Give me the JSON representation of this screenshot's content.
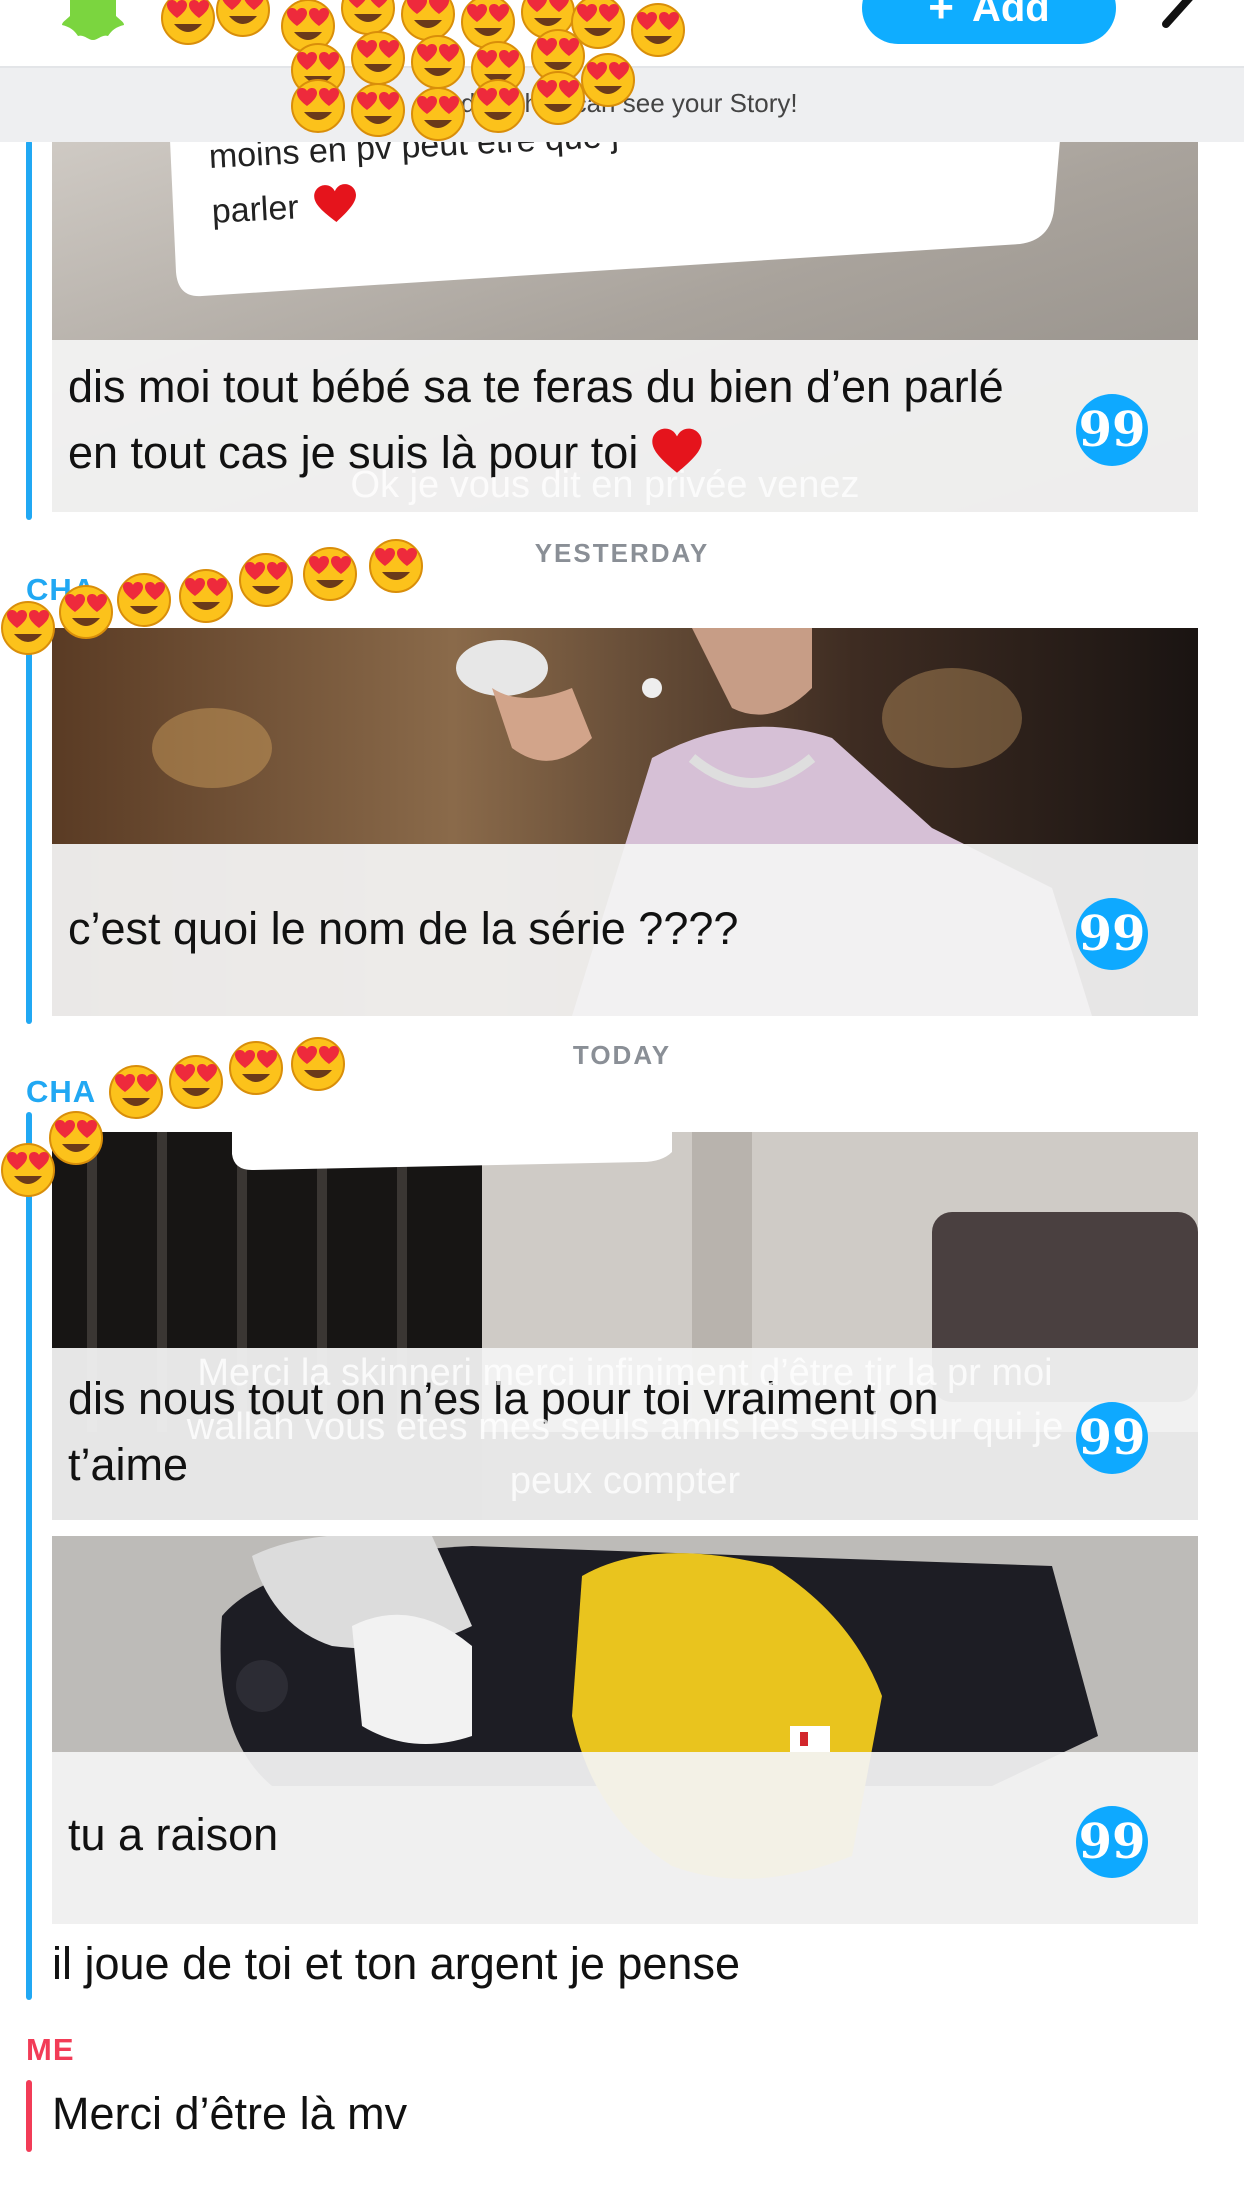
{
  "header": {
    "add_button_label": "Add",
    "banner_text": "nd so they can see your Story!"
  },
  "messages": [
    {
      "caption": "dis moi tout bébé sa te feras du bien d'en parlé en tout cas je suis là pour toi",
      "overlay": "Ok je vous dit en privée venez",
      "snap_text": "moins en pv peut etre que j parler"
    }
  ],
  "conversation": {
    "divider_yesterday": "YESTERDAY",
    "divider_today": "TODAY",
    "sender_1": "CHA",
    "sender_2": "CHA",
    "sender_me": "ME",
    "msg1": {
      "snap_line1": "moins en pv peut etre que j",
      "snap_line2": "parler",
      "caption": "dis moi tout bébé sa te feras du bien d’en parlé en tout cas je suis là pour toi",
      "overlay": "Ok je vous dit en privée venez"
    },
    "msg2": {
      "caption": "c’est quoi le nom de la série ????"
    },
    "msg3": {
      "caption": "dis nous tout on n’es la pour toi vraiment on t’aime",
      "overlay_line1": "Merci la skinneri merci infiniment d’être tjr la pr moi",
      "overlay_line2": "wallah vous etes mes seuls amis les seuls sur qui je",
      "overlay_line3": "peux compter"
    },
    "msg4": {
      "caption": "tu a raison"
    },
    "msg5": "il joue de toi et ton argent je pense",
    "msg_me": "Merci d’être là mv"
  },
  "colors": {
    "snap_blue": "#0fadff",
    "friend_bar": "#21a8f3",
    "me_red": "#f23c57"
  },
  "icons": [
    "ghost-icon",
    "add-friend-icon",
    "chevron-icon",
    "quote-icon",
    "heart-emoji",
    "heart-eyes-emoji"
  ]
}
